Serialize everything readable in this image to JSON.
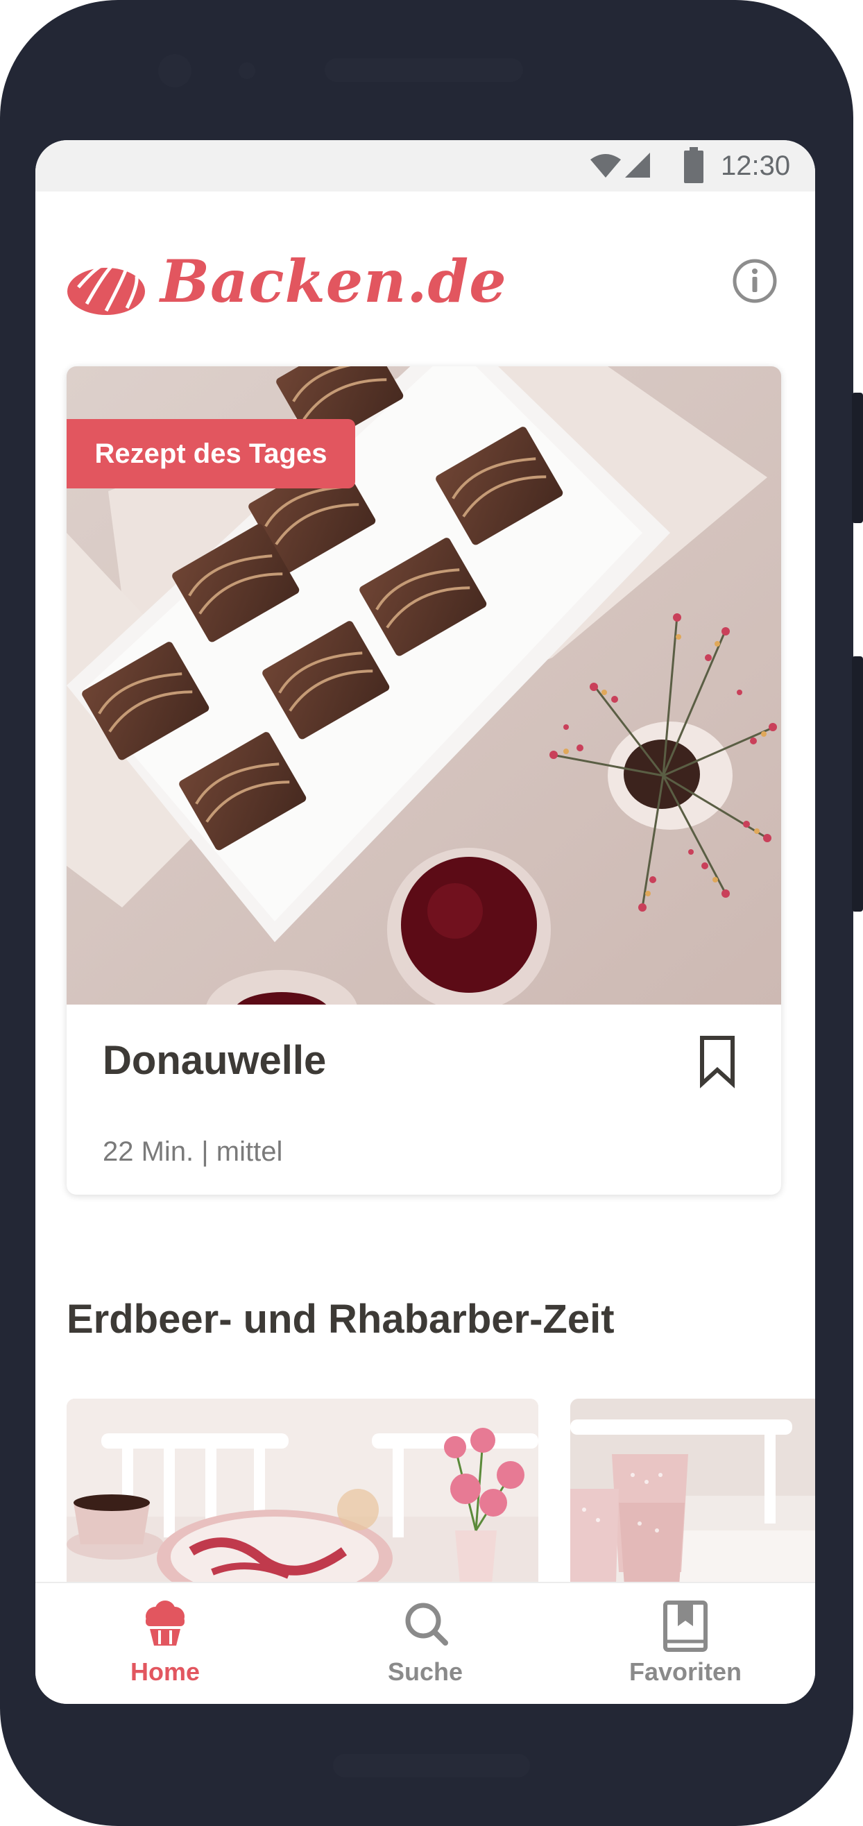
{
  "status_bar": {
    "time": "12:30",
    "icons": [
      "wifi-icon",
      "cellular-signal-icon",
      "battery-icon"
    ]
  },
  "header": {
    "logo_text": "Backen.de",
    "logo_icon": "bundt-cake-icon",
    "info_icon": "info-icon"
  },
  "featured": {
    "badge": "Rezept des Tages",
    "title": "Donauwelle",
    "meta": "22 Min. | mittel",
    "bookmark_icon": "bookmark-icon"
  },
  "section": {
    "title": "Erdbeer- und Rhabarber-Zeit"
  },
  "nav": {
    "items": [
      {
        "label": "Home",
        "icon": "cupcake-icon",
        "active": true
      },
      {
        "label": "Suche",
        "icon": "search-icon",
        "active": false
      },
      {
        "label": "Favoriten",
        "icon": "bookmark-book-icon",
        "active": false
      }
    ]
  },
  "colors": {
    "brand": "#e2565f",
    "phone_frame": "#232735",
    "text_dark": "#3d3a36",
    "text_muted": "#7a7a7a",
    "nav_inactive": "#8a8a8a"
  }
}
